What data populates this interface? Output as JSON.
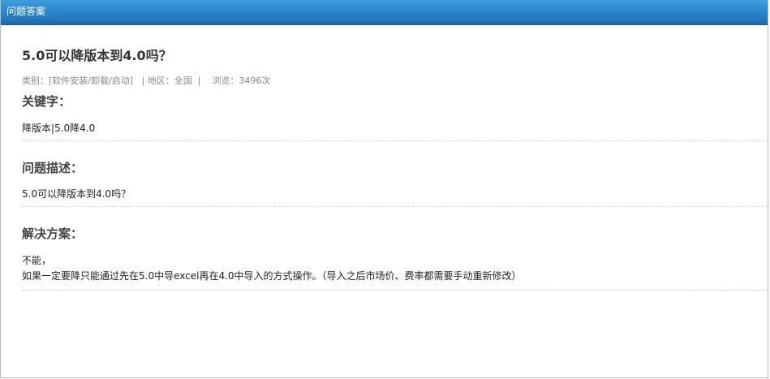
{
  "window": {
    "title": "问题答案"
  },
  "question": {
    "title": "5.0可以降版本到4.0吗？",
    "meta": {
      "category": "类别：[软件安装/卸载/启动]",
      "separator1": "|",
      "region": "地区：全国",
      "separator2": "|",
      "views": "浏览：3496次"
    }
  },
  "sections": {
    "keywords": {
      "heading": "关键字：",
      "text": "降版本|5.0降4.0"
    },
    "description": {
      "heading": "问题描述：",
      "text": "5.0可以降版本到4.0吗？"
    },
    "solution": {
      "heading": "解决方案：",
      "line1": "不能，",
      "line2": "如果一定要降只能通过先在5.0中导excel再在4.0中导入的方式操作。（导入之后市场价、费率都需要手动重新修改）"
    }
  },
  "colors": {
    "titlebar_top": "#3e9ede",
    "titlebar_bottom": "#1f6fb3",
    "meta_text": "#888888",
    "divider": "#d8d8d8"
  }
}
